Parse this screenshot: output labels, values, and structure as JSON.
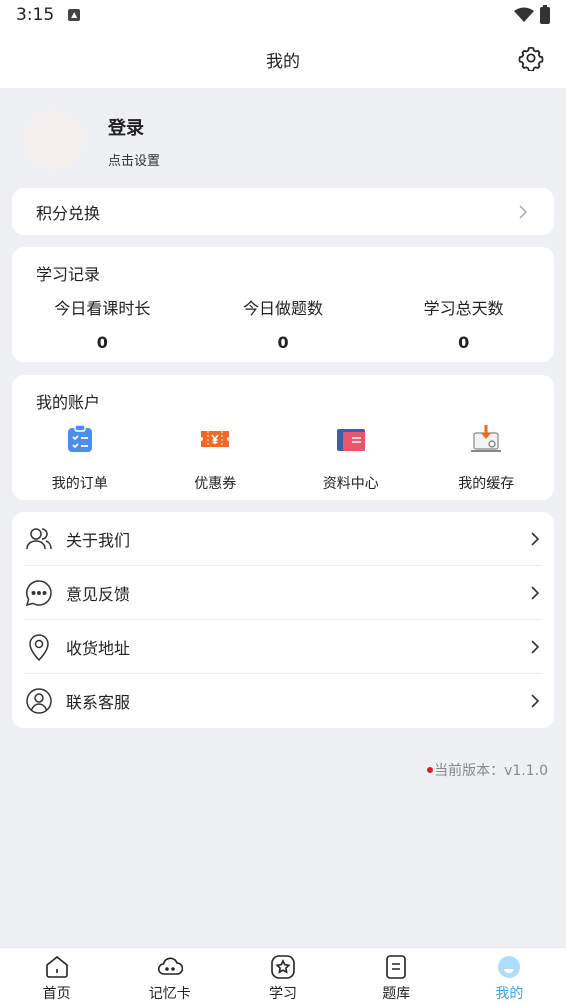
{
  "status_bar": {
    "time": "3:15"
  },
  "header": {
    "title": "我的"
  },
  "profile": {
    "name": "登录",
    "subtitle": "点击设置"
  },
  "points": {
    "label": "积分兑换"
  },
  "study_record": {
    "title": "学习记录",
    "stats": [
      {
        "label": "今日看课时长",
        "value": "0"
      },
      {
        "label": "今日做题数",
        "value": "0"
      },
      {
        "label": "学习总天数",
        "value": "0"
      }
    ]
  },
  "account": {
    "title": "我的账户",
    "items": [
      {
        "label": "我的订单",
        "icon": "order-icon"
      },
      {
        "label": "优惠券",
        "icon": "coupon-icon"
      },
      {
        "label": "资料中心",
        "icon": "folder-icon"
      },
      {
        "label": "我的缓存",
        "icon": "download-cache-icon"
      }
    ]
  },
  "menu": [
    {
      "label": "关于我们",
      "icon": "users-icon"
    },
    {
      "label": "意见反馈",
      "icon": "chat-icon"
    },
    {
      "label": "收货地址",
      "icon": "location-icon"
    },
    {
      "label": "联系客服",
      "icon": "customer-service-icon"
    }
  ],
  "version": {
    "text": "当前版本：v1.1.0"
  },
  "tabs": [
    {
      "label": "首页",
      "icon": "home-icon"
    },
    {
      "label": "记忆卡",
      "icon": "cloud-icon"
    },
    {
      "label": "学习",
      "icon": "star-icon"
    },
    {
      "label": "题库",
      "icon": "document-icon"
    },
    {
      "label": "我的",
      "icon": "profile-icon",
      "active": true
    }
  ],
  "colors": {
    "accent": "#3ba3f7",
    "background": "#eef0f4",
    "coupon": "#f26a21",
    "order": "#4b8ef0",
    "version_dot": "#e02020"
  }
}
